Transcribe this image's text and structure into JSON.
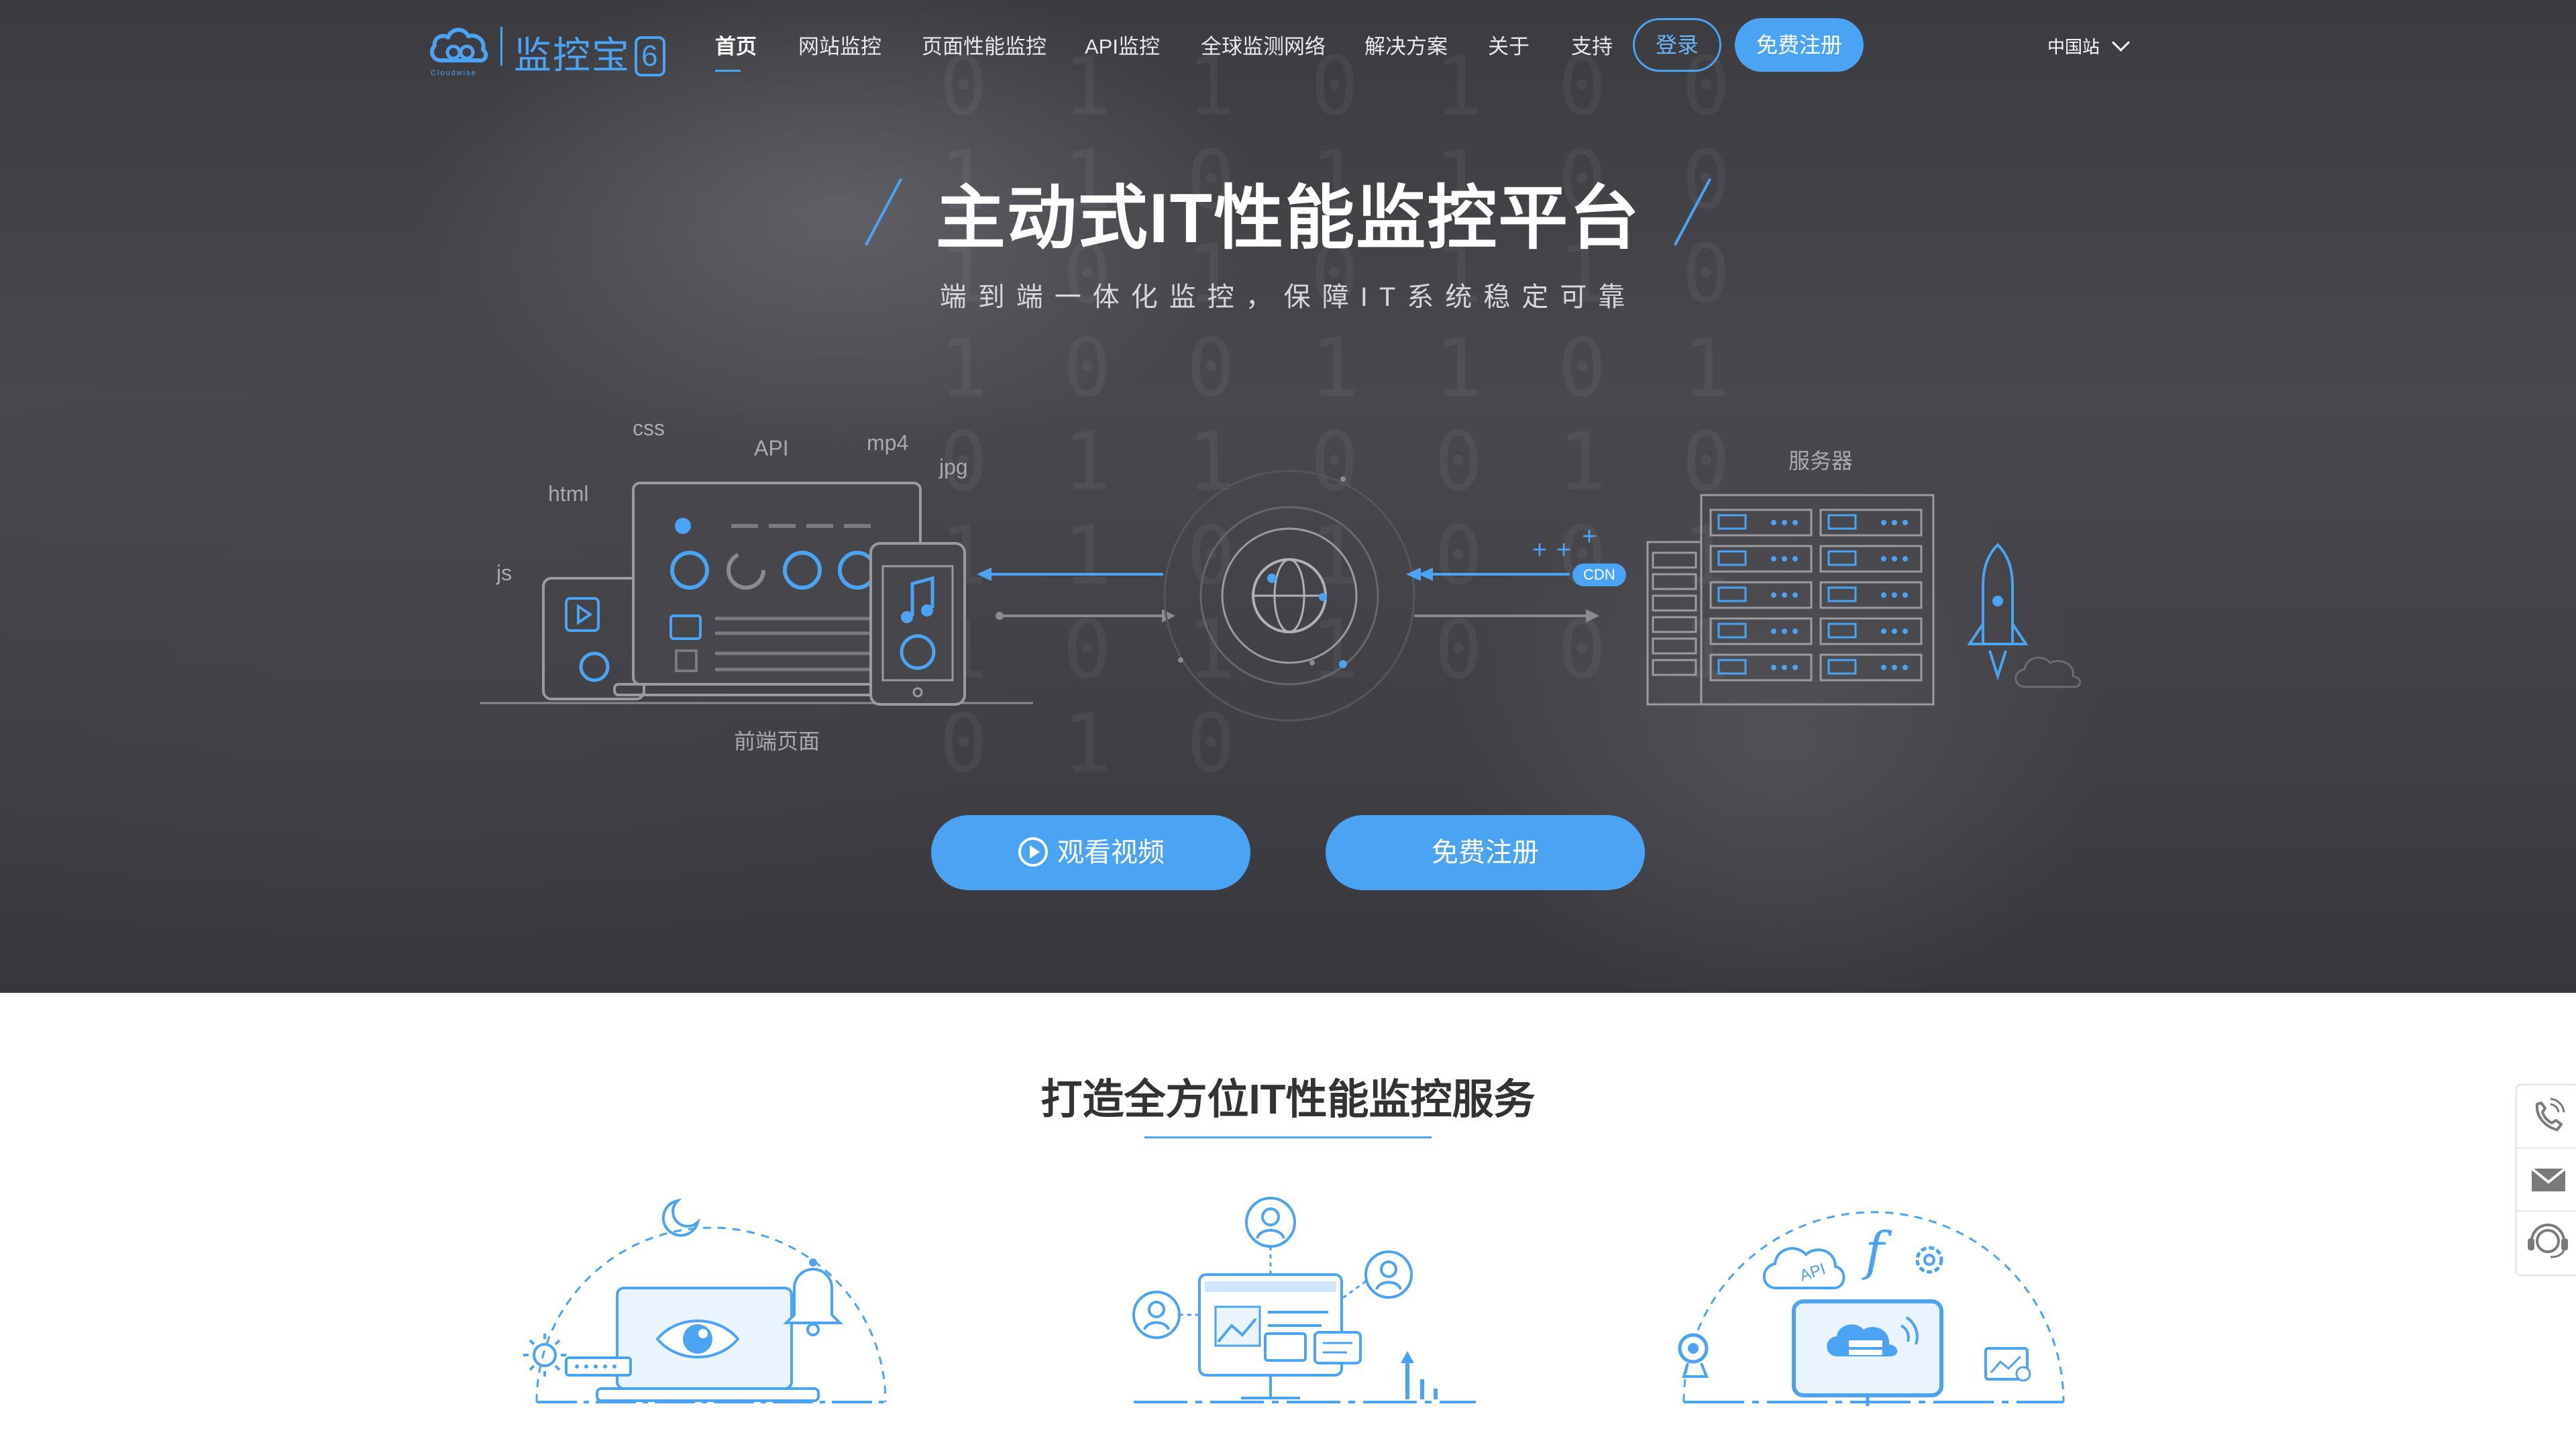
{
  "brand": {
    "name": "监控宝",
    "version_badge": "6",
    "tagline": "Cloudwise"
  },
  "nav": {
    "items": [
      {
        "label": "首页",
        "active": true
      },
      {
        "label": "网站监控"
      },
      {
        "label": "页面性能监控"
      },
      {
        "label": "API监控"
      },
      {
        "label": "全球监测网络"
      },
      {
        "label": "解决方案"
      },
      {
        "label": "关于"
      },
      {
        "label": "支持"
      }
    ],
    "login_label": "登录",
    "register_label": "免费注册",
    "region_label": "中国站"
  },
  "hero": {
    "title": "主动式IT性能监控平台",
    "subtitle": "端到端一体化监控，保障IT系统稳定可靠",
    "illustration": {
      "frontend_tags": [
        "css",
        "API",
        "mp4",
        "jpg",
        "html",
        "js"
      ],
      "frontend_label": "前端页面",
      "server_label": "服务器",
      "cdn_label": "CDN"
    },
    "watch_video_label": "观看视频",
    "register_label": "免费注册"
  },
  "services": {
    "title": "打造全方位IT性能监控服务",
    "cards": [
      {
        "icon": "monitoring-24h-icon"
      },
      {
        "icon": "user-experience-icon"
      },
      {
        "icon": "cloud-api-icon"
      }
    ],
    "api_badge": "API"
  },
  "side_toolbar": [
    {
      "icon": "phone-icon"
    },
    {
      "icon": "mail-icon"
    },
    {
      "icon": "customer-service-icon"
    }
  ],
  "colors": {
    "accent": "#4aa3f3",
    "hero_bg": "#3f3f44",
    "heading": "#333333"
  }
}
